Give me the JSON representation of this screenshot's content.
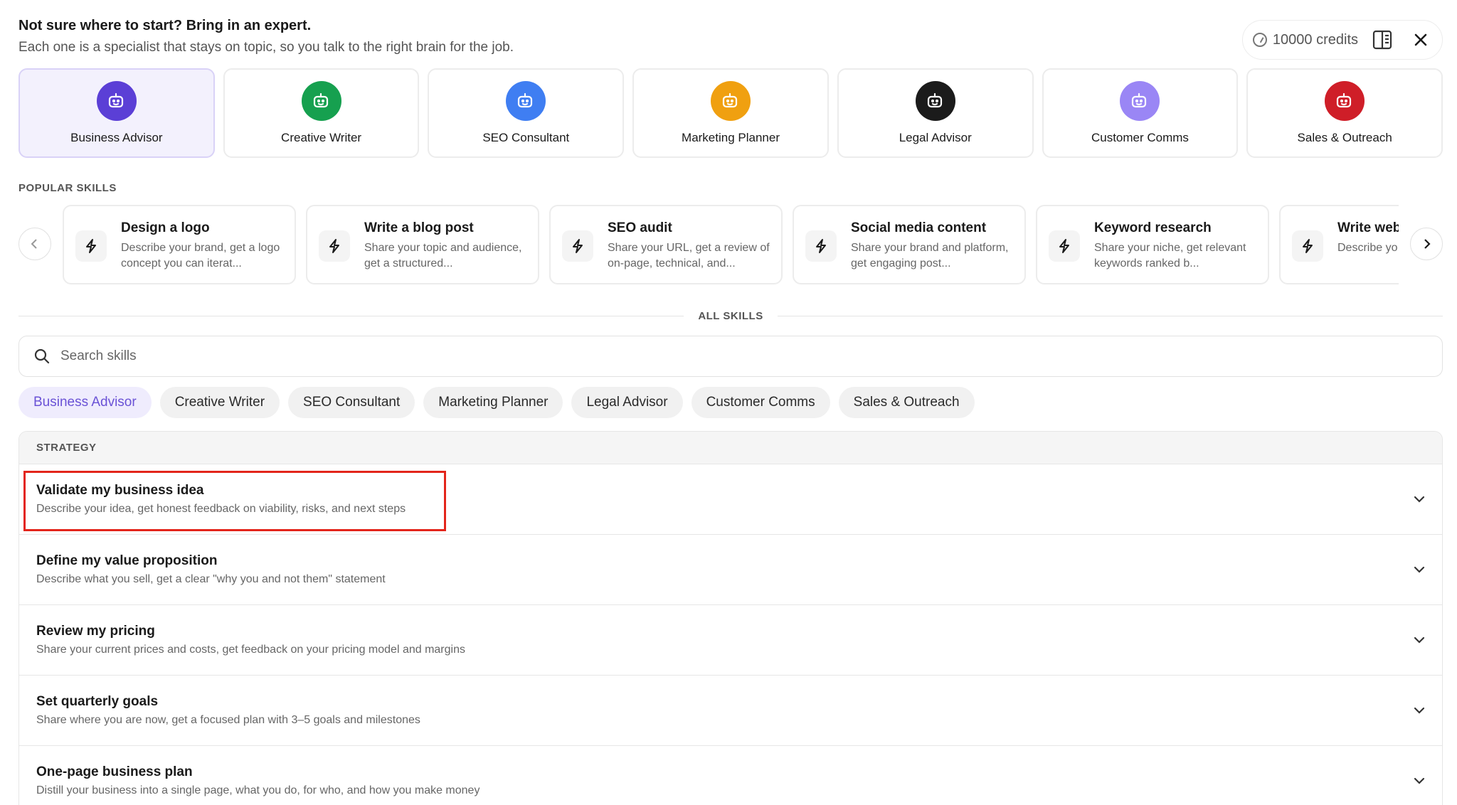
{
  "intro": {
    "title": "Not sure where to start? Bring in an expert.",
    "subtitle": "Each one is a specialist that stays on topic, so you talk to the right brain for the job."
  },
  "topbar": {
    "credits": "10000 credits",
    "icons": [
      "coin-icon",
      "panel-icon",
      "close-icon"
    ]
  },
  "colors": {
    "accent": "#6a52d6",
    "active_card_bg": "#f3f1fd",
    "highlight": "#e3251b"
  },
  "experts": [
    {
      "label": "Business Advisor",
      "color": "#5b3fd6",
      "active": true
    },
    {
      "label": "Creative Writer",
      "color": "#16a04f",
      "active": false
    },
    {
      "label": "SEO Consultant",
      "color": "#3f7ef2",
      "active": false
    },
    {
      "label": "Marketing Planner",
      "color": "#f0a010",
      "active": false
    },
    {
      "label": "Legal Advisor",
      "color": "#1b1b1b",
      "active": false
    },
    {
      "label": "Customer Comms",
      "color": "#9a86f5",
      "active": false
    },
    {
      "label": "Sales & Outreach",
      "color": "#cf1e28",
      "active": false
    }
  ],
  "popular": {
    "label": "POPULAR SKILLS",
    "skills": [
      {
        "title": "Design a logo",
        "desc": "Describe your brand, get a logo concept you can iterat..."
      },
      {
        "title": "Write a blog post",
        "desc": "Share your topic and audience, get a structured..."
      },
      {
        "title": "SEO audit",
        "desc": "Share your URL, get a review of on-page, technical, and..."
      },
      {
        "title": "Social media content",
        "desc": "Share your brand and platform, get engaging post..."
      },
      {
        "title": "Keyword research",
        "desc": "Share your niche, get relevant keywords ranked b..."
      },
      {
        "title": "Write web",
        "desc": "Describe yo goal, get co"
      }
    ]
  },
  "all_skills": {
    "label": "ALL SKILLS",
    "search_placeholder": "Search skills"
  },
  "chips": [
    {
      "label": "Business Advisor",
      "active": true
    },
    {
      "label": "Creative Writer",
      "active": false
    },
    {
      "label": "SEO Consultant",
      "active": false
    },
    {
      "label": "Marketing Planner",
      "active": false
    },
    {
      "label": "Legal Advisor",
      "active": false
    },
    {
      "label": "Customer Comms",
      "active": false
    },
    {
      "label": "Sales & Outreach",
      "active": false
    }
  ],
  "list": {
    "section": "STRATEGY",
    "rows": [
      {
        "title": "Validate my business idea",
        "desc": "Describe your idea, get honest feedback on viability, risks, and next steps"
      },
      {
        "title": "Define my value proposition",
        "desc": "Describe what you sell, get a clear \"why you and not them\" statement"
      },
      {
        "title": "Review my pricing",
        "desc": "Share your current prices and costs, get feedback on your pricing model and margins"
      },
      {
        "title": "Set quarterly goals",
        "desc": "Share where you are now, get a focused plan with 3–5 goals and milestones"
      },
      {
        "title": "One-page business plan",
        "desc": "Distill your business into a single page, what you do, for who, and how you make money"
      }
    ]
  }
}
